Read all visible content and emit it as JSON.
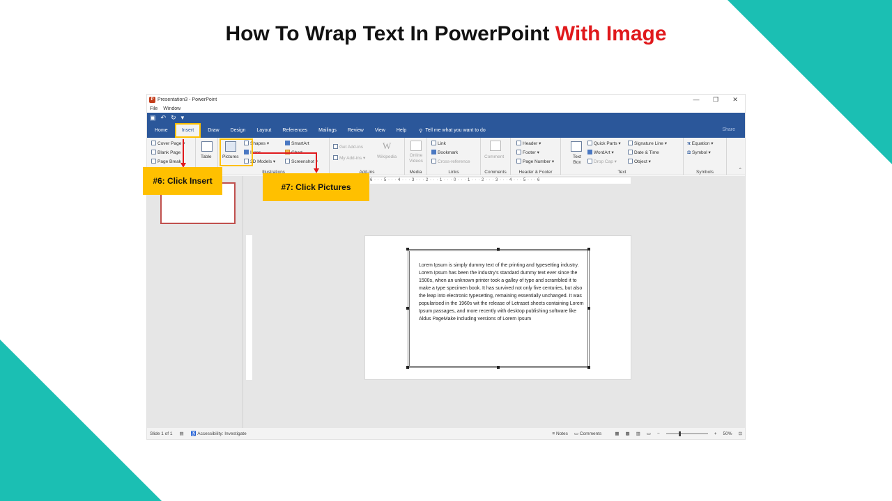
{
  "slide": {
    "title_main": "How To Wrap Text In PowerPoint",
    "title_accent": "With Image",
    "accent_color": "#e0191c",
    "decoration_color": "#1bbfb3"
  },
  "window": {
    "title": "Presentation3 - PowerPoint",
    "menu": [
      "File",
      "Window"
    ],
    "tabs": [
      "Home",
      "Insert",
      "Draw",
      "Design",
      "Layout",
      "References",
      "Mailings",
      "Review",
      "View",
      "Help"
    ],
    "tell_me": "Tell me what you want to do",
    "share": "Share"
  },
  "ribbon": {
    "pages": [
      "Cover Page",
      "Blank Page",
      "Page Break"
    ],
    "table": "Table",
    "pictures": "Pictures",
    "shapes": "Shapes",
    "icons": "Icons",
    "models": "3D Models",
    "smartart": "SmartArt",
    "chart": "Chart",
    "screenshot": "Screenshot",
    "illustrations": "Illustrations",
    "get_addins": "Get Add-ins",
    "my_addins": "My Add-ins",
    "wikipedia": "Wikipedia",
    "addins": "Add-ins",
    "online_videos": "Online Videos",
    "media": "Media",
    "link": "Link",
    "bookmark": "Bookmark",
    "crossref": "Cross-reference",
    "links": "Links",
    "comment": "Comment",
    "comments_group": "Comments",
    "header": "Header",
    "footer": "Footer",
    "page_number": "Page Number",
    "header_footer": "Header & Footer",
    "text_box": "Text Box",
    "quick_parts": "Quick Parts",
    "wordart": "WordArt",
    "drop_cap": "Drop Cap",
    "signature_line": "Signature Line",
    "date_time": "Date & Time",
    "object": "Object",
    "text_group": "Text",
    "equation": "Equation",
    "symbol": "Symbol",
    "symbols": "Symbols"
  },
  "ruler": {
    "horizontal": "6 · · · 5 · · · 4 · · · 3 · · · 2 · · · 1 · · · 0 · · · 1 · · · 2 · · · 3 · · · 4 · · · 5 · · · 6"
  },
  "document": {
    "body": "Lorem Ipsum is simply dummy text of the printing and typesetting industry. Lorem Ipsum has been the industry's standard dummy text ever since the 1500s, when an unknown printer took a galley of type and scrambled it to make a type specimen book. It has survived not only five centuries, but also the leap into electronic typesetting, remaining essentially unchanged. It was popularised in the 1960s wit the release of Letraset sheets containing Lorem Ipsum passages, and more recently with desktop publishing software like Aldus PageMake including versions of Lorem Ipsum"
  },
  "status": {
    "slide": "Slide 1 of 1",
    "accessibility": "Accessibility: Investigate",
    "notes": "Notes",
    "comments": "Comments",
    "zoom": "50%"
  },
  "callouts": {
    "step6": "#6: Click Insert",
    "step7": "#7: Click Pictures"
  }
}
